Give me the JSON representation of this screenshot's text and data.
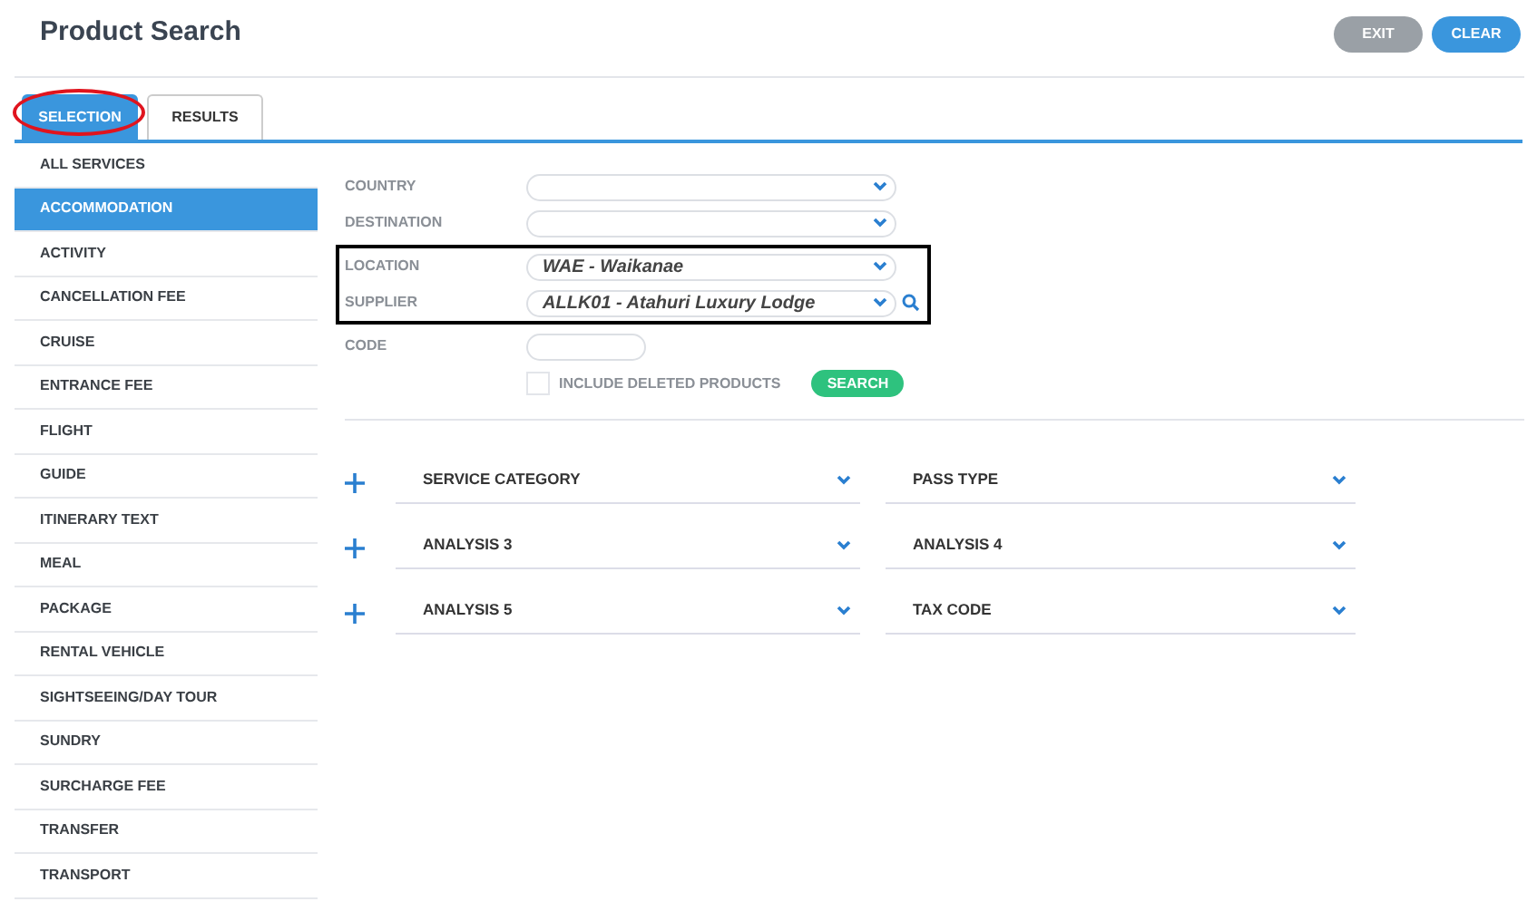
{
  "page_title": "Product Search",
  "header_buttons": [
    {
      "label": "EXIT",
      "kind": "secondary"
    },
    {
      "label": "CLEAR",
      "kind": "primary"
    }
  ],
  "tabs": [
    {
      "label": "SELECTION",
      "selected": true,
      "circled": true
    },
    {
      "label": "RESULTS",
      "selected": false,
      "circled": false
    }
  ],
  "service_types": [
    {
      "label": "ALL SERVICES",
      "selected": false
    },
    {
      "label": "ACCOMMODATION",
      "selected": true
    },
    {
      "label": "ACTIVITY",
      "selected": false
    },
    {
      "label": "CANCELLATION FEE",
      "selected": false
    },
    {
      "label": "CRUISE",
      "selected": false
    },
    {
      "label": "ENTRANCE FEE",
      "selected": false
    },
    {
      "label": "FLIGHT",
      "selected": false
    },
    {
      "label": "GUIDE",
      "selected": false
    },
    {
      "label": "ITINERARY TEXT",
      "selected": false
    },
    {
      "label": "MEAL",
      "selected": false
    },
    {
      "label": "PACKAGE",
      "selected": false
    },
    {
      "label": "RENTAL VEHICLE",
      "selected": false
    },
    {
      "label": "SIGHTSEEING/DAY TOUR",
      "selected": false
    },
    {
      "label": "SUNDRY",
      "selected": false
    },
    {
      "label": "SURCHARGE FEE",
      "selected": false
    },
    {
      "label": "TRANSFER",
      "selected": false
    },
    {
      "label": "TRANSPORT",
      "selected": false
    }
  ],
  "field_groups": [
    {
      "highlighted": false,
      "fields": [
        {
          "label": "COUNTRY",
          "kind": "select"
        },
        {
          "label": "DESTINATION",
          "kind": "select"
        }
      ]
    },
    {
      "highlighted": true,
      "fields": [
        {
          "label": "LOCATION",
          "kind": "select",
          "value": "WAE - Waikanae"
        },
        {
          "label": "SUPPLIER",
          "kind": "lookup",
          "value": "ALLK01 - Atahuri Luxury Lodge"
        }
      ]
    },
    {
      "highlighted": false,
      "fields": [
        {
          "label": "CODE",
          "kind": "text"
        }
      ]
    }
  ],
  "include_deleted": {
    "label": "INCLUDE DELETED PRODUCTS",
    "checked": false
  },
  "search_button": "SEARCH",
  "filter_rows": [
    [
      "SERVICE CATEGORY",
      "PASS TYPE"
    ],
    [
      "ANALYSIS 3",
      "ANALYSIS 4"
    ],
    [
      "ANALYSIS 5",
      "TAX CODE"
    ]
  ]
}
